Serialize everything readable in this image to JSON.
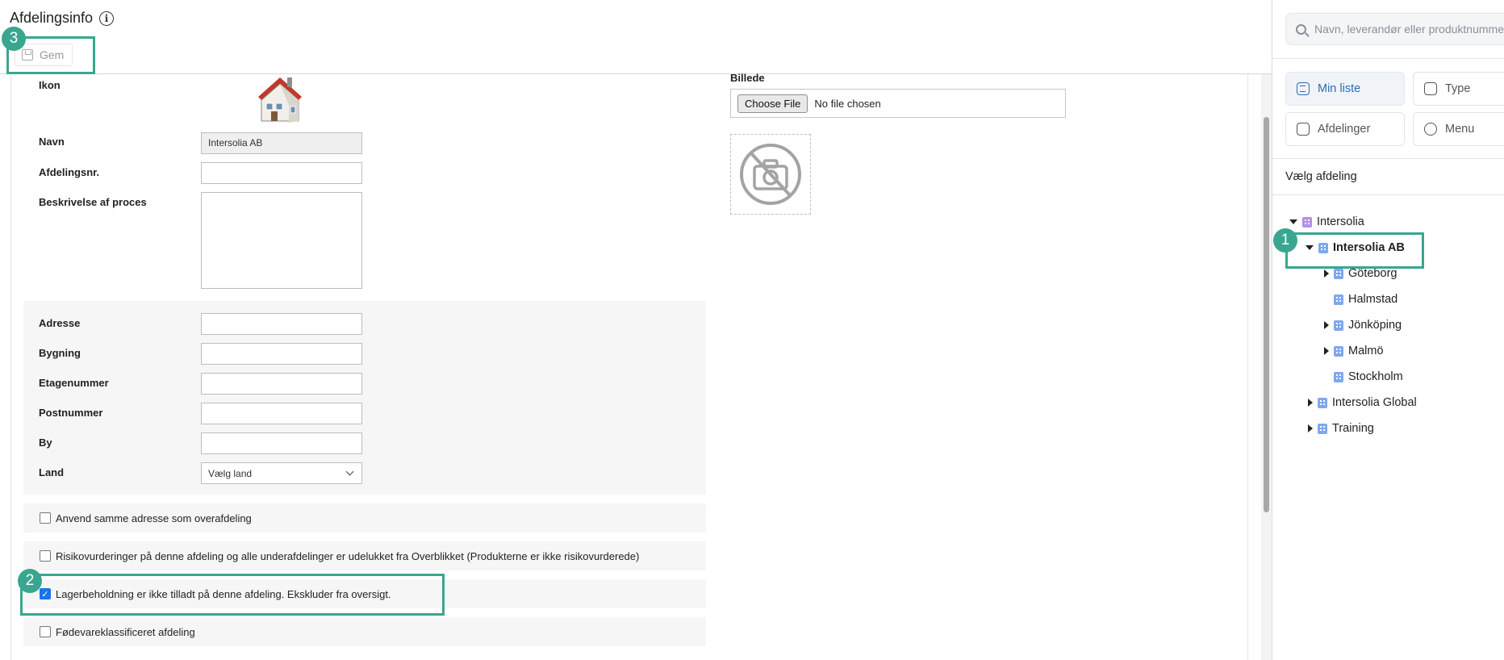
{
  "header": {
    "title": "Afdelingsinfo",
    "save_label": "Gem"
  },
  "form": {
    "icon_label": "Ikon",
    "name_label": "Navn",
    "name_value": "Intersolia AB",
    "dept_no_label": "Afdelingsnr.",
    "dept_no_value": "",
    "description_label": "Beskrivelse af proces",
    "address_label": "Adresse",
    "building_label": "Bygning",
    "floor_label": "Etagenummer",
    "postal_label": "Postnummer",
    "city_label": "By",
    "country_label": "Land",
    "country_value": "Vælg land",
    "image_label": "Billede",
    "choose_file_label": "Choose File",
    "no_file_label": "No file chosen"
  },
  "checkboxes": [
    {
      "label": "Anvend samme adresse som overafdeling",
      "checked": false
    },
    {
      "label": "Risikovurderinger på denne afdeling og alle underafdelinger er udelukket fra Overblikket (Produkterne er ikke risikovurderede)",
      "checked": false
    },
    {
      "label": "Lagerbeholdning er ikke tilladt på denne afdeling. Ekskluder fra oversigt.",
      "checked": true
    },
    {
      "label": "Fødevareklassificeret afdeling",
      "checked": false
    }
  ],
  "annotations": [
    "1",
    "2",
    "3"
  ],
  "sidebar": {
    "search_placeholder": "Navn, leverandør eller produktnummer",
    "buttons": [
      {
        "label": "Min liste",
        "icon": "list-icon",
        "active": true
      },
      {
        "label": "Type",
        "icon": "type-icon",
        "active": false
      },
      {
        "label": "Afdelinger",
        "icon": "departments-icon",
        "active": false
      },
      {
        "label": "Menu",
        "icon": "menu-icon",
        "active": false
      }
    ],
    "section_title": "Vælg afdeling",
    "tree": [
      {
        "label": "Intersolia",
        "level": 0,
        "toggle": "open"
      },
      {
        "label": "Intersolia AB",
        "level": 1,
        "toggle": "open",
        "selected": true
      },
      {
        "label": "Göteborg",
        "level": 2,
        "toggle": "closed"
      },
      {
        "label": "Halmstad",
        "level": 2,
        "toggle": "none"
      },
      {
        "label": "Jönköping",
        "level": 2,
        "toggle": "closed"
      },
      {
        "label": "Malmö",
        "level": 2,
        "toggle": "closed"
      },
      {
        "label": "Stockholm",
        "level": 2,
        "toggle": "none"
      },
      {
        "label": "Intersolia Global",
        "level": 1,
        "toggle": "closed"
      },
      {
        "label": "Training",
        "level": 1,
        "toggle": "closed"
      }
    ]
  },
  "colors": {
    "highlight": "#3aa68f",
    "active_button_text": "#2b6cb0"
  }
}
